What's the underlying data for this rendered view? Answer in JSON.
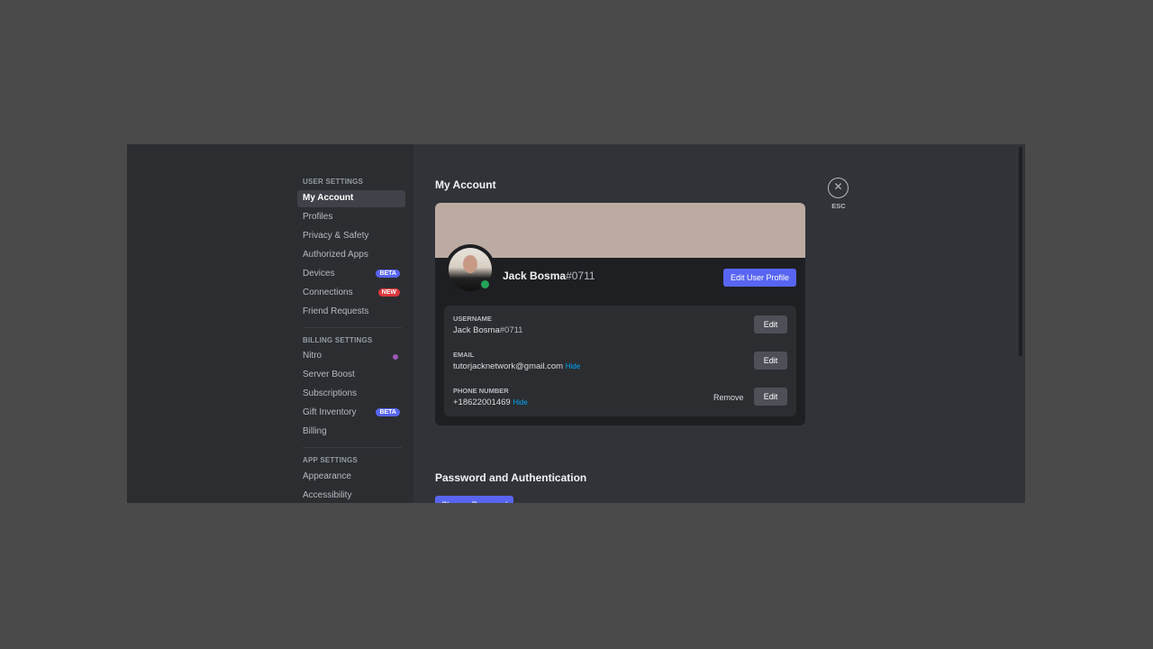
{
  "sidebar": {
    "sections": [
      {
        "header": "USER SETTINGS",
        "items": [
          {
            "label": "My Account",
            "active": true
          },
          {
            "label": "Profiles"
          },
          {
            "label": "Privacy & Safety"
          },
          {
            "label": "Authorized Apps"
          },
          {
            "label": "Devices",
            "badge": "BETA"
          },
          {
            "label": "Connections",
            "badge": "NEW"
          },
          {
            "label": "Friend Requests"
          }
        ]
      },
      {
        "header": "BILLING SETTINGS",
        "items": [
          {
            "label": "Nitro",
            "icon": "nitro-icon"
          },
          {
            "label": "Server Boost"
          },
          {
            "label": "Subscriptions"
          },
          {
            "label": "Gift Inventory",
            "badge": "BETA"
          },
          {
            "label": "Billing"
          }
        ]
      },
      {
        "header": "APP SETTINGS",
        "items": [
          {
            "label": "Appearance"
          },
          {
            "label": "Accessibility"
          }
        ]
      }
    ]
  },
  "main": {
    "title": "My Account",
    "profile": {
      "name": "Jack Bosma",
      "discriminator": "#0711",
      "edit_profile_label": "Edit User Profile",
      "status": "online",
      "banner_color": "#bcaba3"
    },
    "fields": [
      {
        "label": "USERNAME",
        "value": "Jack Bosma",
        "value_suffix": "#0711",
        "edit": "Edit"
      },
      {
        "label": "EMAIL",
        "value": "tutorjacknetwork@gmail.com",
        "hide": "Hide",
        "edit": "Edit"
      },
      {
        "label": "PHONE NUMBER",
        "value": "+18622001469",
        "hide": "Hide",
        "remove": "Remove",
        "edit": "Edit"
      }
    ],
    "password_section": {
      "title": "Password and Authentication",
      "change_password_label": "Change Password"
    }
  },
  "close": {
    "label": "ESC",
    "icon": "close-icon"
  },
  "colors": {
    "accent": "#5865f2",
    "beta": "#5865f2",
    "new": "#da373c",
    "online": "#23a55a",
    "link": "#00a8fc"
  }
}
